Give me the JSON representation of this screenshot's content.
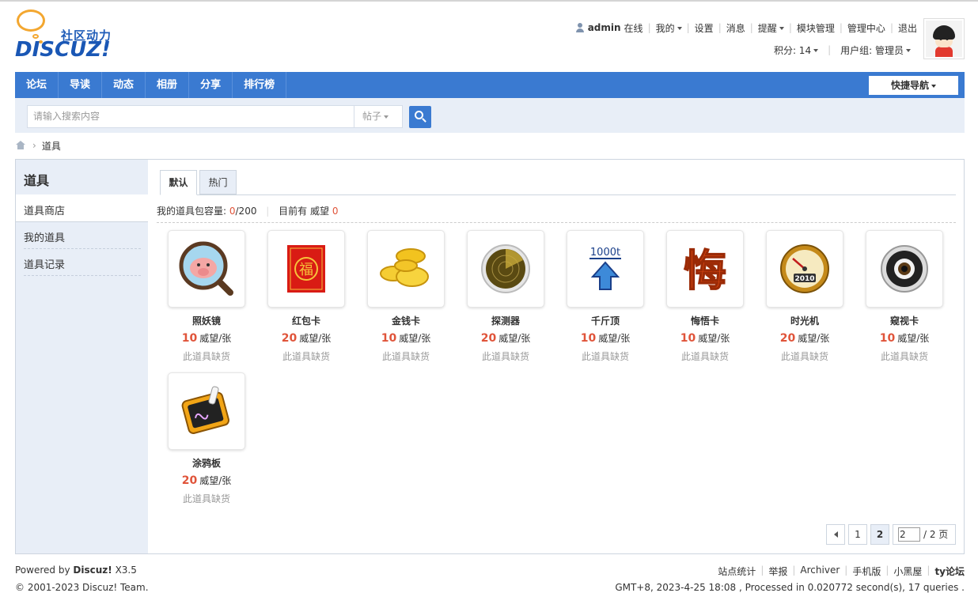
{
  "logo": {
    "sub": "社区动力",
    "main": "DISCUZ!"
  },
  "user": {
    "name": "admin",
    "status": "在线",
    "menu": [
      "我的",
      "设置",
      "消息",
      "提醒",
      "模块管理",
      "管理中心",
      "退出"
    ],
    "credits": "积分: 14",
    "group": "用户组: 管理员"
  },
  "nav": {
    "items": [
      "论坛",
      "导读",
      "动态",
      "相册",
      "分享",
      "排行榜"
    ],
    "quick": "快捷导航"
  },
  "search": {
    "placeholder": "请输入搜索内容",
    "type": "帖子"
  },
  "breadcrumb": {
    "current": "道具"
  },
  "sidebar": {
    "title": "道具",
    "items": [
      "道具商店",
      "我的道具",
      "道具记录"
    ]
  },
  "tabs": [
    "默认",
    "热门"
  ],
  "capacity": {
    "label": "我的道具包容量:",
    "used": "0",
    "total": "/200",
    "current_label": "目前有 威望",
    "current_value": "0"
  },
  "props": [
    {
      "name": "照妖镜",
      "price": "10",
      "unit": "威望/张",
      "stock": "此道具缺货",
      "icon": "magnifier-pig-icon"
    },
    {
      "name": "红包卡",
      "price": "20",
      "unit": "威望/张",
      "stock": "此道具缺货",
      "icon": "red-envelope-icon"
    },
    {
      "name": "金钱卡",
      "price": "10",
      "unit": "威望/张",
      "stock": "此道具缺货",
      "icon": "gold-coins-icon"
    },
    {
      "name": "探测器",
      "price": "20",
      "unit": "威望/张",
      "stock": "此道具缺货",
      "icon": "radar-icon"
    },
    {
      "name": "千斤顶",
      "price": "10",
      "unit": "威望/张",
      "stock": "此道具缺货",
      "icon": "jack-arrow-icon"
    },
    {
      "name": "悔悟卡",
      "price": "10",
      "unit": "威望/张",
      "stock": "此道具缺货",
      "icon": "regret-char-icon"
    },
    {
      "name": "时光机",
      "price": "20",
      "unit": "威望/张",
      "stock": "此道具缺货",
      "icon": "time-gauge-icon"
    },
    {
      "name": "窥视卡",
      "price": "10",
      "unit": "威望/张",
      "stock": "此道具缺货",
      "icon": "eye-lens-icon"
    },
    {
      "name": "涂鸦板",
      "price": "20",
      "unit": "威望/张",
      "stock": "此道具缺货",
      "icon": "graffiti-board-icon"
    }
  ],
  "icon_texts": {
    "red_envelope_char": "福",
    "jack_label": "1000t",
    "regret_char": "悔",
    "gauge_year": "2010"
  },
  "pager": {
    "pages": [
      "1",
      "2"
    ],
    "current": "2",
    "jump_value": "2",
    "jump_total": "/ 2 页"
  },
  "footer": {
    "powered_prefix": "Powered by",
    "powered_name": "Discuz!",
    "powered_ver": "X3.5",
    "copyright": "© 2001-2023 Discuz! Team.",
    "links": [
      "站点统计",
      "举报",
      "Archiver",
      "手机版",
      "小黑屋",
      "ty论坛"
    ],
    "info": "GMT+8, 2023-4-25 18:08 , Processed in 0.020772 second(s), 17 queries ."
  },
  "colors": {
    "nav": "#3a7ad1",
    "accent_red": "#e0543a",
    "side_bg": "#e8eef7"
  }
}
